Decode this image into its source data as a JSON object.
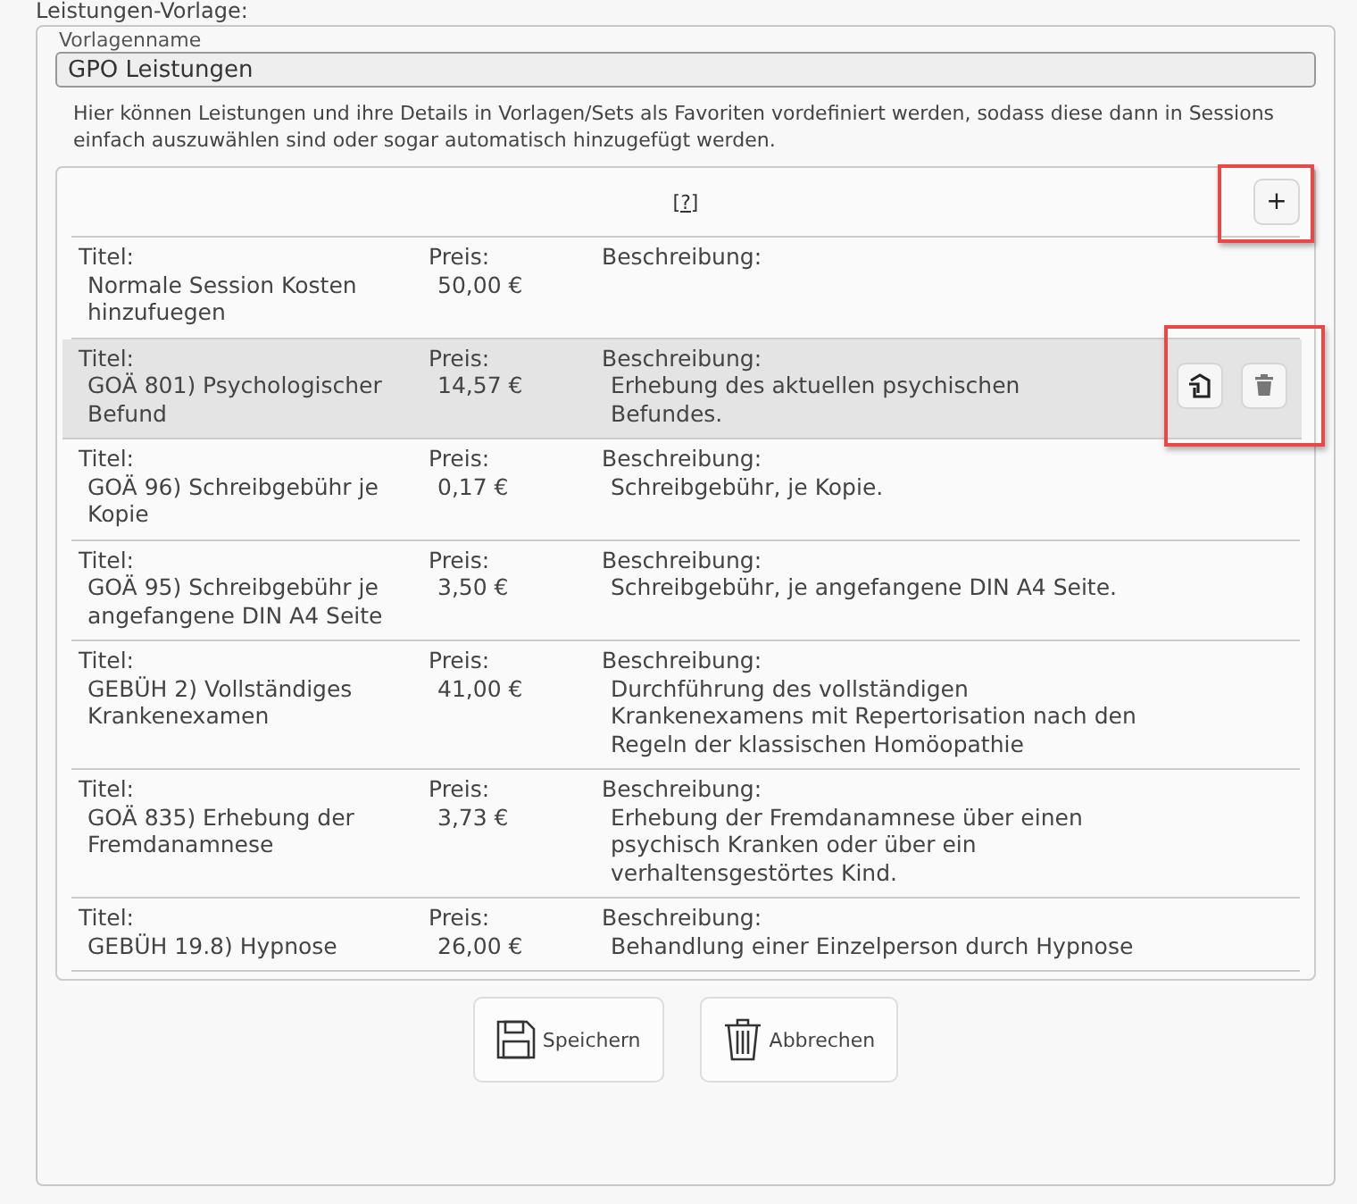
{
  "heading": "Leistungen-Vorlage:",
  "name_field": {
    "label": "Vorlagenname",
    "value": "GPO Leistungen"
  },
  "description": "Hier können Leistungen und ihre Details in Vorlagen/Sets als Favoriten vordefiniert werden, sodass diese dann in Sessions einfach auszuwählen sind oder sogar automatisch hinzugefügt werden.",
  "list": {
    "help_link": "[?]",
    "add_button": {
      "label": "+",
      "highlighted": true
    },
    "rows": [
      {
        "labels": [
          "Titel:",
          "Preis:",
          "Beschreibung:"
        ],
        "title": "Normale Session Kosten hinzufuegen",
        "price": "50,00 €",
        "description": "",
        "selected": false
      },
      {
        "labels": [
          "Titel:",
          "Preis:",
          "Beschreibung:"
        ],
        "title": "GOÄ 801) Psychologischer Befund",
        "price": "14,57 €",
        "description": "Erhebung des aktuellen psychischen Befundes.",
        "selected": true,
        "actions_highlighted": true
      },
      {
        "labels": [
          "Titel:",
          "Preis:",
          "Beschreibung:"
        ],
        "title": "GOÄ 96) Schreibgebühr je Kopie",
        "price": "0,17 €",
        "description": "Schreibgebühr, je Kopie.",
        "selected": false
      },
      {
        "labels": [
          "Titel:",
          "Preis:",
          "Beschreibung:"
        ],
        "title": "GOÄ 95) Schreibgebühr je angefangene DIN A4 Seite",
        "price": "3,50 €",
        "description": "Schreibgebühr, je angefangene DIN A4 Seite.",
        "selected": false
      },
      {
        "labels": [
          "Titel:",
          "Preis:",
          "Beschreibung:"
        ],
        "title": "GEBÜH 2) Vollständiges Krankenexamen",
        "price": "41,00 €",
        "description": "Durchführung des vollständigen Krankenexamens mit Repertorisation nach den Regeln der klassischen Homöopathie",
        "selected": false
      },
      {
        "labels": [
          "Titel:",
          "Preis:",
          "Beschreibung:"
        ],
        "title": "GOÄ 835) Erhebung der Fremdanamnese",
        "price": "3,73 €",
        "description": "Erhebung der Fremdanamnese über einen psychisch Kranken oder über ein verhaltensgestörtes Kind.",
        "selected": false
      },
      {
        "labels": [
          "Titel:",
          "Preis:",
          "Beschreibung:"
        ],
        "title": "GEBÜH 19.8) Hypnose",
        "price": "26,00 €",
        "description": "Behandlung einer Einzelperson durch Hypnose",
        "selected": false
      }
    ]
  },
  "buttons": [
    {
      "kind": "save",
      "label": "Speichern"
    },
    {
      "kind": "cancel",
      "label": "Abbrechen"
    }
  ]
}
